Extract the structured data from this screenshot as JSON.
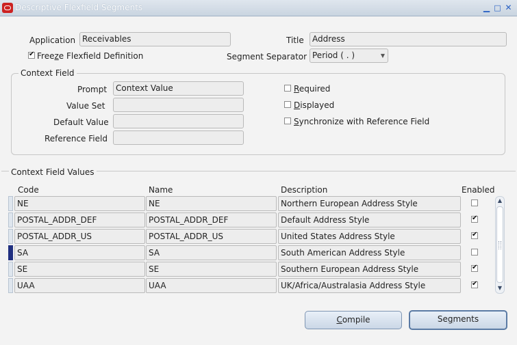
{
  "window": {
    "title": "Descriptive Flexfield Segments"
  },
  "header": {
    "application_label": "Application",
    "application_value": "Receivables",
    "title_label": "Title",
    "title_value": "Address",
    "freeze_pre": "Free",
    "freeze_accel": "z",
    "freeze_post": "e Flexfield Definition",
    "freeze_checked": true,
    "separator_label": "Segment Separator",
    "separator_value": "Period ( . )"
  },
  "context_field": {
    "group_title": "Context Field",
    "prompt_label": "Prompt",
    "prompt_value": "Context Value",
    "value_set_label": "Value Set",
    "value_set_value": "",
    "default_value_label": "Default Value",
    "default_value_value": "",
    "reference_field_label": "Reference Field",
    "reference_field_value": "",
    "required_accel": "R",
    "required_rest": "equired",
    "displayed_accel": "D",
    "displayed_rest": "isplayed",
    "sync_accel": "S",
    "sync_rest": "ynchronize with Reference Field"
  },
  "values": {
    "section_title": "Context Field Values",
    "columns": {
      "code": "Code",
      "name": "Name",
      "description": "Description",
      "enabled": "Enabled"
    },
    "rows": [
      {
        "code": "NE",
        "name": "NE",
        "description": "Northern European Address Style",
        "enabled": false
      },
      {
        "code": "POSTAL_ADDR_DEF",
        "name": "POSTAL_ADDR_DEF",
        "description": "Default Address Style",
        "enabled": true
      },
      {
        "code": "POSTAL_ADDR_US",
        "name": "POSTAL_ADDR_US",
        "description": "United States Address Style",
        "enabled": true
      },
      {
        "code": "SA",
        "name": "SA",
        "description": "South American Address Style",
        "enabled": false
      },
      {
        "code": "SE",
        "name": "SE",
        "description": "Southern European Address Style",
        "enabled": true
      },
      {
        "code": "UAA",
        "name": "UAA",
        "description": "UK/Africa/Australasia Address Style",
        "enabled": true
      }
    ],
    "current_row": 3
  },
  "buttons": {
    "compile_accel": "C",
    "compile_rest": "ompile",
    "segments_pre": "Se",
    "segments_accel": "g",
    "segments_post": "ments"
  },
  "icons": {
    "minimize": "minimize-icon",
    "maximize": "maximize-icon",
    "close": "close-icon",
    "dropdown": "chevron-down-icon",
    "check": "check-icon"
  }
}
